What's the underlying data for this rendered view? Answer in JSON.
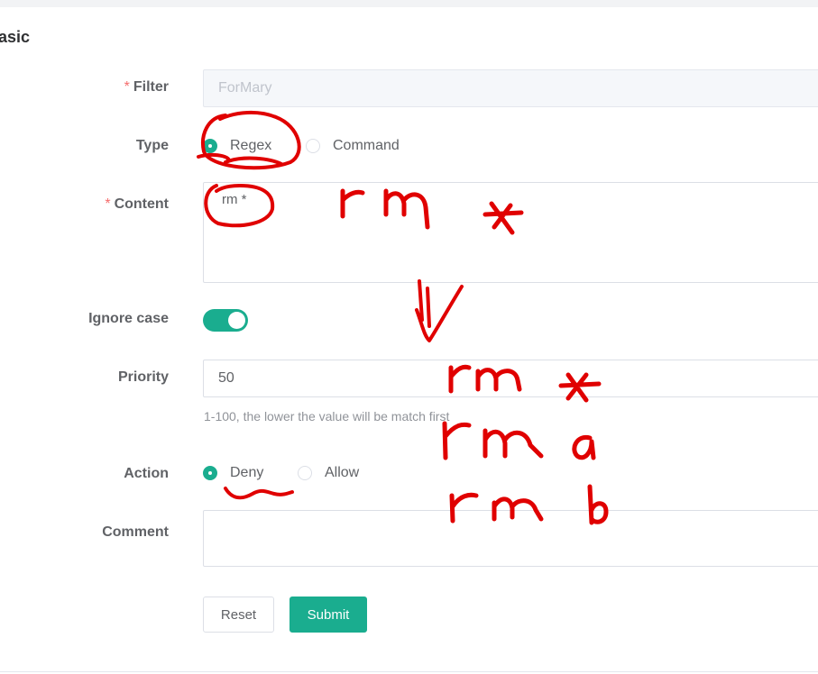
{
  "section": {
    "title": "asic"
  },
  "form": {
    "filter": {
      "label": "Filter",
      "required": true,
      "value": "ForMary",
      "disabled": true
    },
    "type": {
      "label": "Type",
      "options": [
        {
          "label": "Regex",
          "checked": true
        },
        {
          "label": "Command",
          "checked": false
        }
      ]
    },
    "content": {
      "label": "Content",
      "required": true,
      "value": "rm *"
    },
    "ignore_case": {
      "label": "Ignore case",
      "on": true
    },
    "priority": {
      "label": "Priority",
      "value": "50",
      "hint": "1-100, the lower the value will be match first"
    },
    "action": {
      "label": "Action",
      "options": [
        {
          "label": "Deny",
          "checked": true
        },
        {
          "label": "Allow",
          "checked": false
        }
      ]
    },
    "comment": {
      "label": "Comment",
      "value": ""
    }
  },
  "buttons": {
    "reset": "Reset",
    "submit": "Submit"
  },
  "annotation": {
    "color": "#e00000",
    "lines": [
      "rm *",
      "rm *",
      "rm a",
      "rm b"
    ]
  },
  "colors": {
    "accent": "#1aad8f",
    "required": "#f56c6c"
  }
}
